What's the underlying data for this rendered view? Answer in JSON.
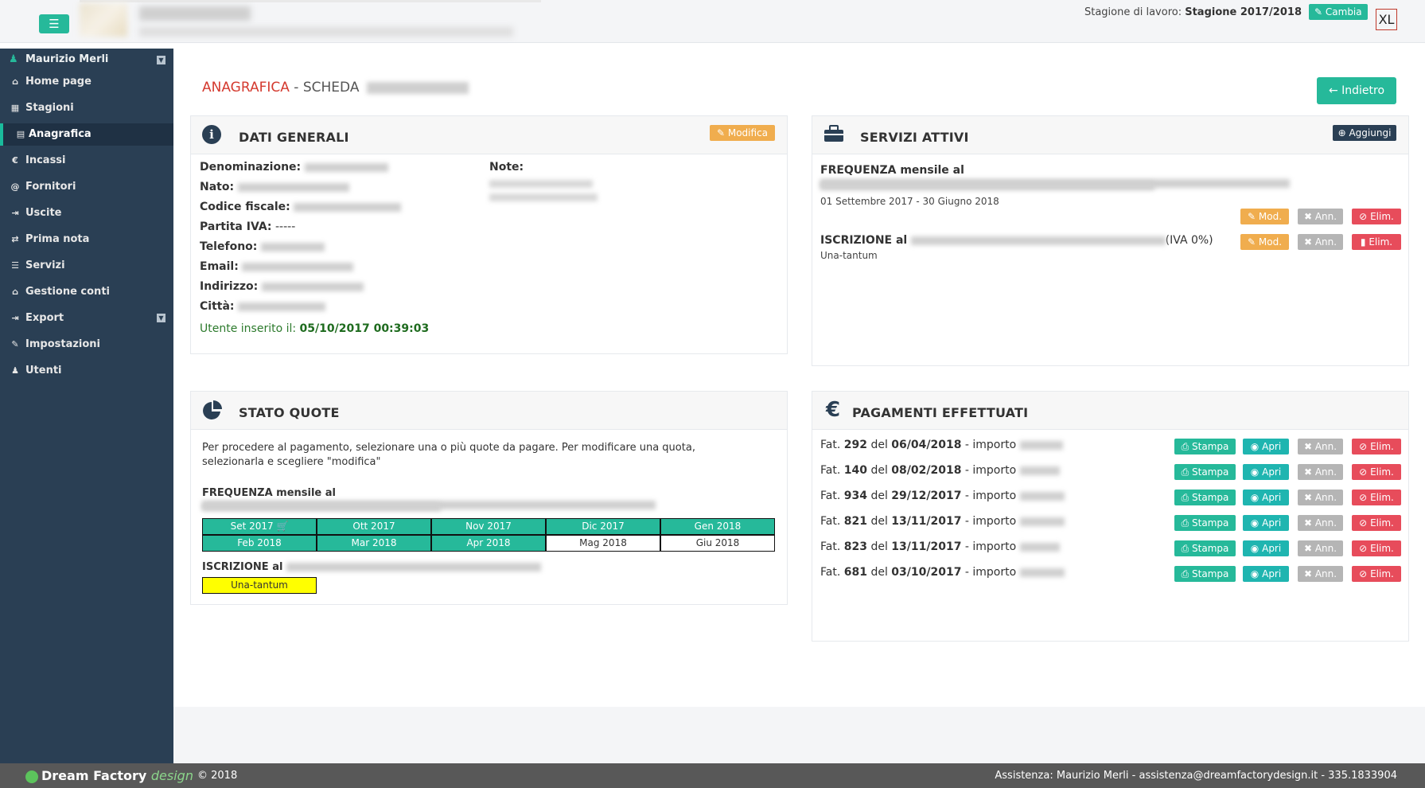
{
  "header": {
    "menu_icon": "hamburger-icon",
    "season_label": "Stagione di lavoro:",
    "season_value": "Stagione 2017/2018",
    "change_label": "Cambia",
    "xl_label": "XL"
  },
  "sidebar": {
    "user": "Maurizio Merli",
    "items": [
      {
        "label": "Home page",
        "icon": "home-icon"
      },
      {
        "label": "Stagioni",
        "icon": "calendar-icon"
      },
      {
        "label": "Anagrafica",
        "icon": "id-card-icon"
      },
      {
        "label": "Incassi",
        "icon": "euro-icon"
      },
      {
        "label": "Fornitori",
        "icon": "at-icon"
      },
      {
        "label": "Uscite",
        "icon": "sign-out-icon"
      },
      {
        "label": "Prima nota",
        "icon": "exchange-icon"
      },
      {
        "label": "Servizi",
        "icon": "list-icon"
      },
      {
        "label": "Gestione conti",
        "icon": "bank-icon"
      },
      {
        "label": "Export",
        "icon": "export-icon"
      },
      {
        "label": "Impostazioni",
        "icon": "wrench-icon"
      },
      {
        "label": "Utenti",
        "icon": "users-icon"
      }
    ]
  },
  "page": {
    "title_red": "ANAGRAFICA",
    "title_rest": " - SCHEDA",
    "back_label": "Indietro"
  },
  "dati_generali": {
    "title": "DATI GENERALI",
    "edit_label": "Modifica",
    "fields": [
      {
        "label": "Denominazione:"
      },
      {
        "label": "Nato:"
      },
      {
        "label": "Codice fiscale:"
      },
      {
        "label": "Partita IVA:",
        "value": "-----"
      },
      {
        "label": "Telefono:"
      },
      {
        "label": "Email:"
      },
      {
        "label": "Indirizzo:"
      },
      {
        "label": "Città:"
      }
    ],
    "note_label": "Note:",
    "inserted_label": "Utente inserito il:",
    "inserted_value": "05/10/2017 00:39:03"
  },
  "servizi": {
    "title": "SERVIZI ATTIVI",
    "add_label": "Aggiungi",
    "items": [
      {
        "prefix": "FREQUENZA mensile al",
        "sub": "01 Settembre 2017 - 30 Giugno 2018"
      },
      {
        "prefix": "ISCRIZIONE al",
        "suffix": "(IVA 0%)",
        "sub": "Una-tantum"
      }
    ],
    "mod_label": "Mod.",
    "ann_label": "Ann.",
    "elim_label": "Elim."
  },
  "stato_quote": {
    "title": "STATO QUOTE",
    "instructions": "Per procedere al pagamento, selezionare una o più quote da pagare. Per modificare una quota, selezionarla e scegliere \"modifica\"",
    "freq_prefix": "FREQUENZA mensile al",
    "months": [
      {
        "label": "Set 2017",
        "paid": true
      },
      {
        "label": "Ott 2017",
        "paid": true
      },
      {
        "label": "Nov 2017",
        "paid": true
      },
      {
        "label": "Dic 2017",
        "paid": true
      },
      {
        "label": "Gen 2018",
        "paid": true
      },
      {
        "label": "Feb 2018",
        "paid": true
      },
      {
        "label": "Mar 2018",
        "paid": true
      },
      {
        "label": "Apr 2018",
        "paid": true
      },
      {
        "label": "Mag 2018",
        "paid": false
      },
      {
        "label": "Giu 2018",
        "paid": false
      }
    ],
    "iscr_prefix": "ISCRIZIONE al",
    "una_label": "Una-tantum"
  },
  "pagamenti": {
    "title": "PAGAMENTI EFFETTUATI",
    "rows": [
      {
        "num": "292",
        "date": "06/04/2018"
      },
      {
        "num": "140",
        "date": "08/02/2018"
      },
      {
        "num": "934",
        "date": "29/12/2017"
      },
      {
        "num": "821",
        "date": "13/11/2017"
      },
      {
        "num": "823",
        "date": "13/11/2017"
      },
      {
        "num": "681",
        "date": "03/10/2017"
      }
    ],
    "fat_label": "Fat.",
    "del_label": "del",
    "importo_label": "- importo",
    "stampa_label": "Stampa",
    "apri_label": "Apri",
    "ann_label": "Ann.",
    "elim_label": "Elim."
  },
  "footer": {
    "brand": "Dream Factory",
    "brand_design": "design",
    "copyright": "© 2018",
    "assist": "Assistenza: Maurizio Merli - assistenza@dreamfactorydesign.it - 335.1833904"
  }
}
